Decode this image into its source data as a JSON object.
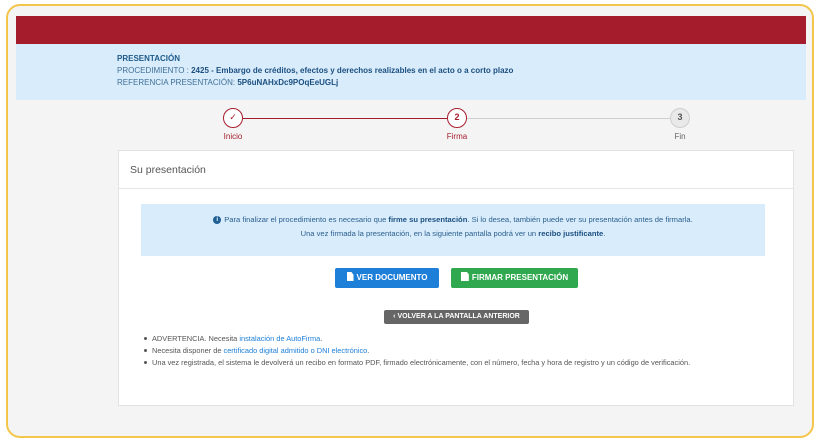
{
  "info": {
    "title": "PRESENTACIÓN",
    "procedure_label": "PROCEDIMIENTO : ",
    "procedure_code": "2425",
    "procedure_sep": " - ",
    "procedure_name": "Embargo de créditos, efectos y derechos realizables en el acto o a corto plazo",
    "reference_label": "REFERENCIA PRESENTACIÓN: ",
    "reference_value": "5P6uNAHxDc9POqEeUGLj"
  },
  "steps": [
    {
      "label": "Inicio",
      "marker": "✓",
      "state": "done"
    },
    {
      "label": "Firma",
      "marker": "2",
      "state": "current"
    },
    {
      "label": "Fin",
      "marker": "3",
      "state": "pending"
    }
  ],
  "panel": {
    "title": "Su presentación",
    "alert": {
      "icon": "info-icon",
      "part1": "Para finalizar el procedimiento es necesario que ",
      "bold1": "firme su presentación",
      "part2": ". Si lo desea, también puede ver su presentación antes de firmarla.",
      "part3": "Una vez firmada la presentación, en la siguiente pantalla podrá ver un ",
      "bold2": "recibo justificante",
      "part4": "."
    },
    "buttons": {
      "view_label": "VER DOCUMENTO",
      "sign_label": "FIRMAR PRESENTACIÓN",
      "back_label": "VOLVER A LA PANTALLA ANTERIOR"
    },
    "warnings": {
      "w1_text": "ADVERTENCIA. Necesita ",
      "w1_link": "instalación de AutoFirma",
      "w1_end": ".",
      "w2_text": "Necesita disponer de ",
      "w2_link": "certificado digital admitido o DNI electrónico",
      "w2_end": ".",
      "w3_text": "Una vez registrada, el sistema le devolverá un recibo en formato PDF, firmado electrónicamente, con el número, fecha y hora de registro y un código de verificación."
    }
  },
  "colors": {
    "brand_red": "#a51d2d",
    "info_blue": "#d9ecfb",
    "button_blue": "#1e7fd9",
    "button_green": "#2fa84f",
    "frame_yellow": "#f3c64a"
  }
}
